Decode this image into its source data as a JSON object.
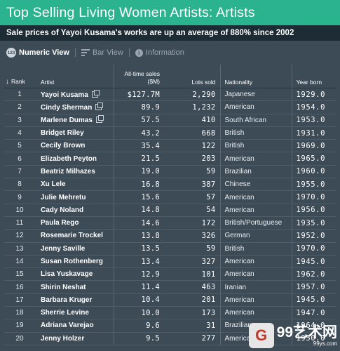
{
  "header": {
    "title": "Top Selling Living Women Artists: Artists",
    "subtitle": "Sale prices of Yayoi Kusama's works are up an average of 880% since 2002"
  },
  "toolbar": {
    "numeric_view": "Numeric View",
    "numeric_icon_text": "123",
    "bar_view": "Bar View",
    "information": "Information"
  },
  "table": {
    "headers": {
      "rank": "Rank",
      "artist": "Artist",
      "sales_line1": "All-time sales",
      "sales_line2": "($M)",
      "lots": "Lots sold",
      "nationality": "Nationality",
      "year": "Year born"
    },
    "rows": [
      {
        "rank": "1",
        "artist": "Yayoi Kusama",
        "sales": "$127.7M",
        "lots": "2,290",
        "nationality": "Japanese",
        "year": "1929.0"
      },
      {
        "rank": "2",
        "artist": "Cindy Sherman",
        "sales": "89.9",
        "lots": "1,232",
        "nationality": "American",
        "year": "1954.0"
      },
      {
        "rank": "3",
        "artist": "Marlene Dumas",
        "sales": "57.5",
        "lots": "410",
        "nationality": "South African",
        "year": "1953.0"
      },
      {
        "rank": "4",
        "artist": "Bridget Riley",
        "sales": "43.2",
        "lots": "668",
        "nationality": "British",
        "year": "1931.0"
      },
      {
        "rank": "5",
        "artist": "Cecily Brown",
        "sales": "35.4",
        "lots": "122",
        "nationality": "British",
        "year": "1969.0"
      },
      {
        "rank": "6",
        "artist": "Elizabeth Peyton",
        "sales": "21.5",
        "lots": "203",
        "nationality": "American",
        "year": "1965.0"
      },
      {
        "rank": "7",
        "artist": "Beatriz Milhazes",
        "sales": "19.0",
        "lots": "59",
        "nationality": "Brazilian",
        "year": "1960.0"
      },
      {
        "rank": "8",
        "artist": "Xu Lele",
        "sales": "16.8",
        "lots": "387",
        "nationality": "Chinese",
        "year": "1955.0"
      },
      {
        "rank": "9",
        "artist": "Julie Mehretu",
        "sales": "15.6",
        "lots": "57",
        "nationality": "American",
        "year": "1970.0"
      },
      {
        "rank": "10",
        "artist": "Cady Noland",
        "sales": "14.8",
        "lots": "54",
        "nationality": "American",
        "year": "1956.0"
      },
      {
        "rank": "11",
        "artist": "Paula Rego",
        "sales": "14.6",
        "lots": "172",
        "nationality": "British/Portuguese",
        "year": "1935.0"
      },
      {
        "rank": "12",
        "artist": "Rosemarie Trockel",
        "sales": "13.8",
        "lots": "326",
        "nationality": "German",
        "year": "1952.0"
      },
      {
        "rank": "13",
        "artist": "Jenny Saville",
        "sales": "13.5",
        "lots": "59",
        "nationality": "British",
        "year": "1970.0"
      },
      {
        "rank": "14",
        "artist": "Susan Rothenberg",
        "sales": "13.4",
        "lots": "327",
        "nationality": "American",
        "year": "1945.0"
      },
      {
        "rank": "15",
        "artist": "Lisa Yuskavage",
        "sales": "12.9",
        "lots": "101",
        "nationality": "American",
        "year": "1962.0"
      },
      {
        "rank": "16",
        "artist": "Shirin Neshat",
        "sales": "11.4",
        "lots": "463",
        "nationality": "Iranian",
        "year": "1957.0"
      },
      {
        "rank": "17",
        "artist": "Barbara Kruger",
        "sales": "10.4",
        "lots": "201",
        "nationality": "American",
        "year": "1945.0"
      },
      {
        "rank": "18",
        "artist": "Sherrie Levine",
        "sales": "10.0",
        "lots": "173",
        "nationality": "American",
        "year": "1947.0"
      },
      {
        "rank": "19",
        "artist": "Adriana Varejao",
        "sales": "9.6",
        "lots": "31",
        "nationality": "Brazilian",
        "year": "1964.0"
      },
      {
        "rank": "20",
        "artist": "Jenny Holzer",
        "sales": "9.5",
        "lots": "277",
        "nationality": "American",
        "year": "1950.0"
      }
    ]
  },
  "watermark": {
    "logo": "G",
    "text": "99艺术网",
    "sub": "99ys.com"
  },
  "colors": {
    "title_bar": "#2bb38f",
    "subtitle_bar": "#1d2b35",
    "background": "#3d4b57"
  }
}
